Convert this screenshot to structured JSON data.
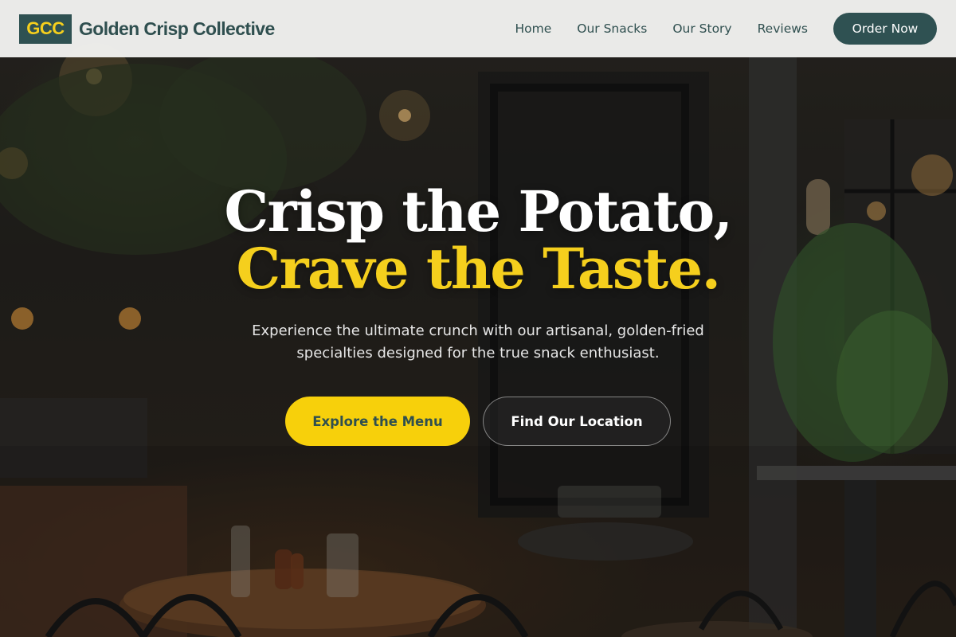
{
  "brand": {
    "logo_text": "GCC",
    "name": "Golden Crisp Collective"
  },
  "nav": {
    "links": [
      "Home",
      "Our Snacks",
      "Our Story",
      "Reviews"
    ],
    "cta": "Order Now"
  },
  "hero": {
    "headline_line1": "Crisp the Potato,",
    "headline_line2": "Crave the Taste.",
    "subtext": "Experience the ultimate crunch with our artisanal, golden-fried specialties designed for the true snack enthusiast.",
    "primary_cta": "Explore the Menu",
    "secondary_cta": "Find Our Location",
    "background": "restaurant-interior-photo"
  },
  "colors": {
    "brand_teal": "#2f5152",
    "accent_yellow": "#f5cf1d",
    "nav_background": "#f2f2f0"
  }
}
